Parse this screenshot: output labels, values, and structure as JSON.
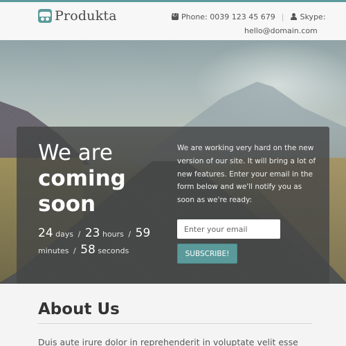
{
  "brand": {
    "name": "Produkta",
    "accent": "#5a9a9b"
  },
  "contact": {
    "phone_label": "Phone: 0039 123 45 679",
    "separator": "|",
    "skype_label": "Skype:",
    "skype_value": "hello@domain.com",
    "phone_icon": "phone-icon",
    "skype_icon": "user-icon"
  },
  "hero": {
    "headline": {
      "line1": "We are",
      "line2": "coming",
      "line3": "soon"
    },
    "countdown": {
      "days": "24",
      "days_label": "days",
      "hours": "23",
      "hours_label": "hours",
      "minutes": "59",
      "minutes_label": "minutes",
      "seconds": "58",
      "seconds_label": "seconds",
      "separator": "/"
    },
    "description": "We are working very hard on the new version of our site. It will bring a lot of new features. Enter your email in the form below and we'll notify you as soon as we're ready:",
    "email_placeholder": "Enter your email",
    "subscribe_label": "SUBSCRIBE!"
  },
  "about": {
    "title": "About Us",
    "text": "Duis aute irure dolor in reprehenderit in voluptate velit esse"
  }
}
